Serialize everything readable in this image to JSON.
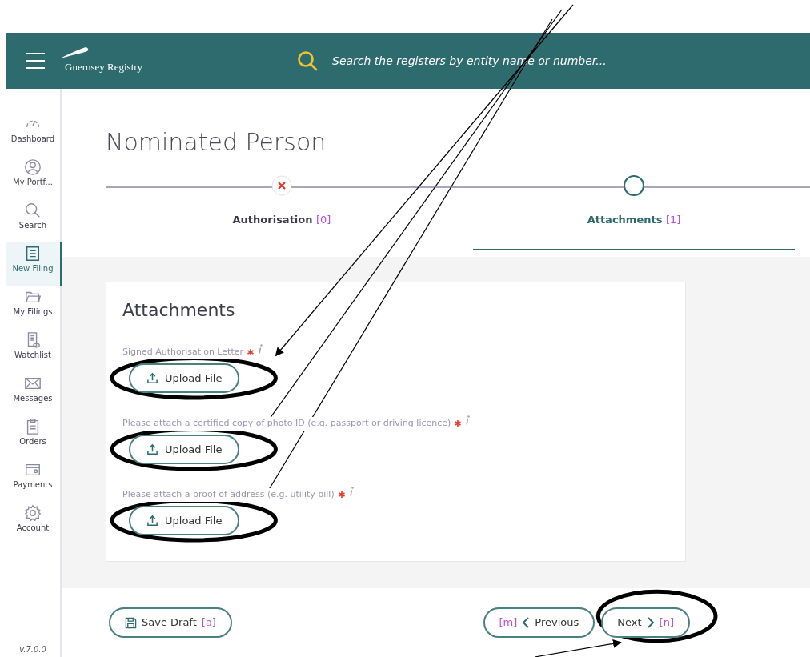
{
  "header": {
    "logo_text": "Guernsey Registry",
    "search": {
      "placeholder": "Search the registers by entity name or number..."
    }
  },
  "sidebar": {
    "items": [
      {
        "label": "Dashboard",
        "kind": "gauge",
        "selected": false
      },
      {
        "label": "My Portf...",
        "kind": "person",
        "selected": false
      },
      {
        "label": "Search",
        "kind": "search",
        "selected": false
      },
      {
        "label": "New Filing",
        "kind": "document",
        "selected": true
      },
      {
        "label": "My Filings",
        "kind": "folder",
        "selected": false
      },
      {
        "label": "Watchlist",
        "kind": "watch",
        "selected": false
      },
      {
        "label": "Messages",
        "kind": "envelope",
        "selected": false
      },
      {
        "label": "Orders",
        "kind": "clipboard",
        "selected": false
      },
      {
        "label": "Payments",
        "kind": "card",
        "selected": false
      },
      {
        "label": "Account",
        "kind": "gear",
        "selected": false
      }
    ],
    "version": "v.7.0.0"
  },
  "page": {
    "title": "Nominated Person",
    "steps": [
      {
        "label": "Authorisation",
        "count": "[0]",
        "kind": "error",
        "selected": false
      },
      {
        "label": "Attachments",
        "count": "[1]",
        "kind": "current",
        "selected": true
      }
    ]
  },
  "card": {
    "title": "Attachments",
    "fields": [
      {
        "label": "Signed Authorisation Letter",
        "required": true,
        "button": "Upload File"
      },
      {
        "label": "Please attach a certified copy of photo ID (e.g. passport or driving licence)",
        "required": true,
        "button": "Upload File"
      },
      {
        "label": "Please attach a proof of address (e.g. utility bill)",
        "required": true,
        "button": "Upload File"
      }
    ]
  },
  "footer": {
    "save": {
      "label": "Save Draft",
      "shortcut": "[a]"
    },
    "previous": {
      "label": "Previous",
      "shortcut": "[m]"
    },
    "next": {
      "label": "Next",
      "shortcut": "[n]"
    }
  }
}
